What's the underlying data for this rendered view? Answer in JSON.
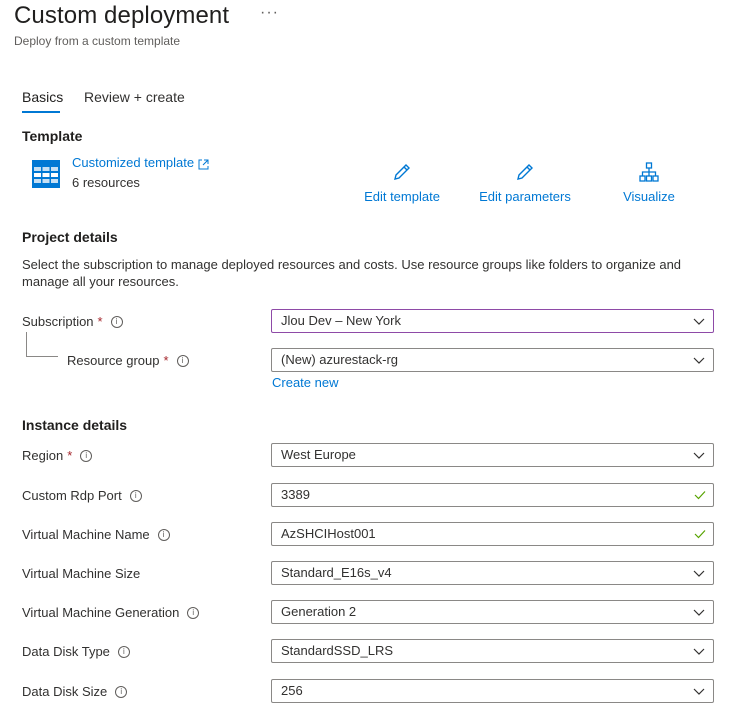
{
  "header": {
    "title": "Custom deployment",
    "more": "···",
    "subtitle": "Deploy from a custom template"
  },
  "tabs": [
    {
      "label": "Basics",
      "active": true
    },
    {
      "label": "Review + create",
      "active": false
    }
  ],
  "template": {
    "heading": "Template",
    "link_label": "Customized template",
    "resources": "6 resources",
    "actions": {
      "edit_template": "Edit template",
      "edit_parameters": "Edit parameters",
      "visualize": "Visualize"
    }
  },
  "project": {
    "heading": "Project details",
    "description": "Select the subscription to manage deployed resources and costs. Use resource groups like folders to organize and manage all your resources.",
    "subscription_label": "Subscription",
    "subscription_value": "Jlou Dev – New York",
    "resource_group_label": "Resource group",
    "resource_group_value": "(New) azurestack-rg",
    "create_new": "Create new"
  },
  "instance": {
    "heading": "Instance details",
    "fields": [
      {
        "label": "Region",
        "value": "West Europe",
        "required": true,
        "kind": "dropdown"
      },
      {
        "label": "Custom Rdp Port",
        "value": "3389",
        "required": false,
        "kind": "text-valid"
      },
      {
        "label": "Virtual Machine Name",
        "value": "AzSHCIHost001",
        "required": false,
        "kind": "text-valid"
      },
      {
        "label": "Virtual Machine Size",
        "value": "Standard_E16s_v4",
        "required": false,
        "kind": "dropdown"
      },
      {
        "label": "Virtual Machine Generation",
        "value": "Generation 2",
        "required": false,
        "kind": "dropdown"
      },
      {
        "label": "Data Disk Type",
        "value": "StandardSSD_LRS",
        "required": false,
        "kind": "dropdown"
      },
      {
        "label": "Data Disk Size",
        "value": "256",
        "required": false,
        "kind": "dropdown"
      }
    ]
  },
  "colors": {
    "accent": "#0078d4",
    "required": "#a4262c",
    "valid": "#57a300",
    "focus_border": "#8e4aa7"
  },
  "icons": {
    "template": "table-grid-icon",
    "external": "external-link-icon",
    "edit": "pencil-icon",
    "visualize": "hierarchy-icon",
    "info": "info-circle-icon",
    "chevron": "chevron-down-icon",
    "check": "checkmark-icon"
  }
}
